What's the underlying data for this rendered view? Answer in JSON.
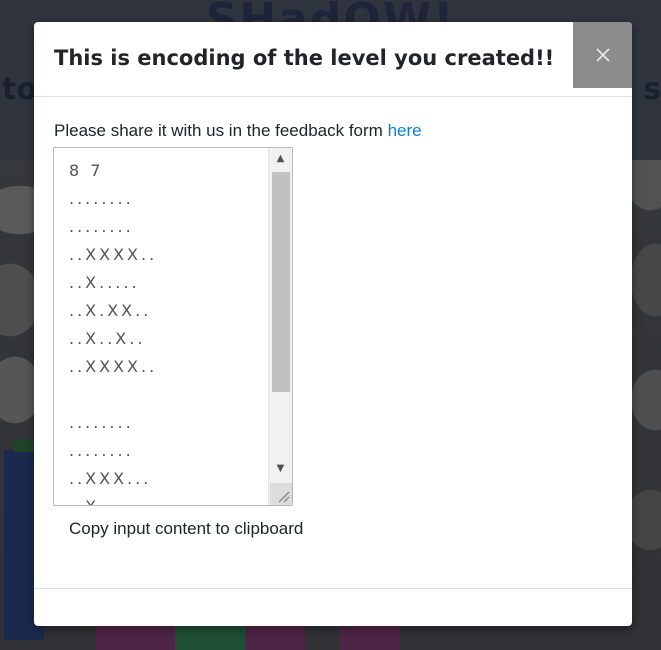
{
  "background": {
    "title": "SHadOW!",
    "subtitle_left": "to",
    "subtitle_right": "s"
  },
  "modal": {
    "title": "This is encoding of the level you created!!",
    "close_icon": "close-icon",
    "share_text": "Please share it with us in the feedback form",
    "share_link_text": "here",
    "encoding": "8 7\n........\n........\n..XXXX..\n..X.....\n..X.XX..\n..X..X..\n..XXXX..\n\n........\n........\n..XXX...\n..X.....",
    "copy_button_label": "Copy input content to clipboard"
  },
  "colors": {
    "link": "#0d7fd6",
    "close_button_bg": "#8c8c8c",
    "overlay": "rgba(0,0,0,0.35)"
  }
}
